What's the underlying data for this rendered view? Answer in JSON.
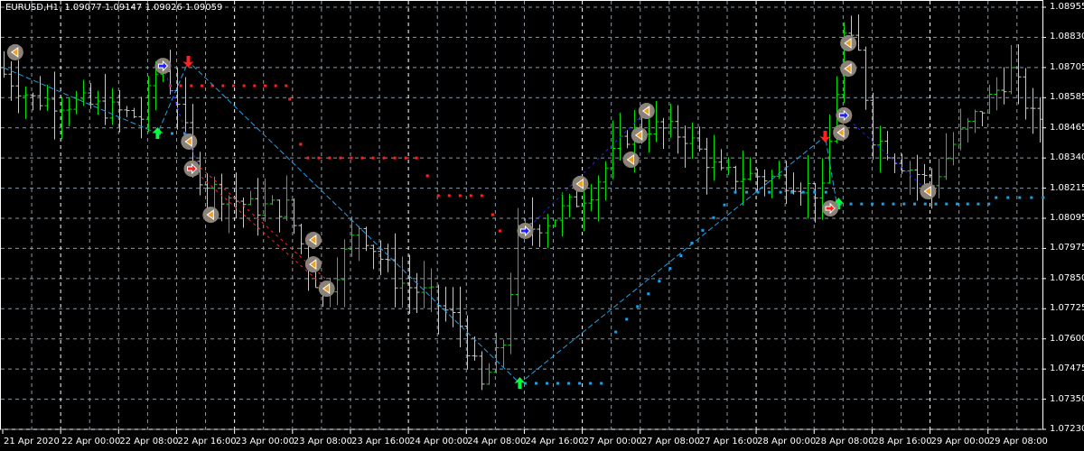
{
  "header": {
    "symbol": "EURUSD,H1",
    "open": "1.09077",
    "high": "1.09147",
    "low": "1.09026",
    "close": "1.09059"
  },
  "colors": {
    "background": "#000000",
    "bull_bar": "#00e000",
    "bear_bar": "#c8c8c8",
    "grid": "#8a9aa8",
    "cyan": "#1ea0e6",
    "red": "#ff2020",
    "blue": "#2020ff",
    "green_arrow": "#00ff40",
    "marker_circle": "#8c8378",
    "marker_triangle": "#f0a020"
  },
  "y_axis": {
    "labels": [
      "1.08955",
      "1.08830",
      "1.08705",
      "1.08585",
      "1.08465",
      "1.08340",
      "1.08215",
      "1.08095",
      "1.07975",
      "1.07850",
      "1.07725",
      "1.07600",
      "1.07475",
      "1.07350",
      "1.07230"
    ],
    "max": 1.08955,
    "min": 1.0723
  },
  "x_axis": {
    "labels": [
      "21 Apr 2020",
      "22 Apr 00:00",
      "22 Apr 08:00",
      "22 Apr 16:00",
      "23 Apr 00:00",
      "23 Apr 08:00",
      "23 Apr 16:00",
      "24 Apr 00:00",
      "24 Apr 08:00",
      "24 Apr 16:00",
      "27 Apr 00:00",
      "27 Apr 08:00",
      "27 Apr 16:00",
      "28 Apr 00:00",
      "28 Apr 08:00",
      "28 Apr 16:00",
      "29 Apr 00:00",
      "29 Apr 08:00"
    ],
    "bars_per_label": 8,
    "day_separator_labels": [
      1,
      4,
      7,
      10,
      13,
      16
    ]
  },
  "chart_data": {
    "type": "ohlc",
    "bar_count": 144,
    "price_path": [
      [
        0,
        1.08708
      ],
      [
        5,
        1.08579
      ],
      [
        12,
        1.08561
      ],
      [
        20,
        1.08505
      ],
      [
        22.5,
        1.08726
      ],
      [
        25,
        1.08579
      ],
      [
        27,
        1.08303
      ],
      [
        30,
        1.0821
      ],
      [
        35,
        1.08137
      ],
      [
        40,
        1.08137
      ],
      [
        45,
        1.07768
      ],
      [
        50,
        1.08063
      ],
      [
        55,
        1.07842
      ],
      [
        60,
        1.07768
      ],
      [
        64,
        1.07657
      ],
      [
        67,
        1.07399
      ],
      [
        70,
        1.07584
      ],
      [
        72,
        1.08026
      ],
      [
        77,
        1.081
      ],
      [
        82,
        1.0821
      ],
      [
        87,
        1.08432
      ],
      [
        90,
        1.08468
      ],
      [
        95,
        1.08432
      ],
      [
        100,
        1.08266
      ],
      [
        105,
        1.08266
      ],
      [
        110,
        1.08247
      ],
      [
        114,
        1.08192
      ],
      [
        115.5,
        1.08505
      ],
      [
        117,
        1.08837
      ],
      [
        119,
        1.08763
      ],
      [
        121,
        1.08432
      ],
      [
        125,
        1.08321
      ],
      [
        129,
        1.08229
      ],
      [
        132,
        1.08395
      ],
      [
        137,
        1.08579
      ],
      [
        140,
        1.0869
      ],
      [
        143,
        1.08505
      ]
    ],
    "markers": [
      [
        1.6,
        1.08771,
        "tri"
      ],
      [
        22,
        1.08715,
        "blue"
      ],
      [
        25.6,
        1.08406,
        "tri"
      ],
      [
        26,
        1.08295,
        "red"
      ],
      [
        28.6,
        1.08107,
        "tri"
      ],
      [
        42.75,
        1.08004,
        "tri"
      ],
      [
        42.75,
        1.07904,
        "tri"
      ],
      [
        44.6,
        1.07805,
        "tri"
      ],
      [
        72,
        1.08041,
        "blue"
      ],
      [
        79.6,
        1.08233,
        "tri"
      ],
      [
        86.6,
        1.08332,
        "tri"
      ],
      [
        87.75,
        1.08432,
        "tri"
      ],
      [
        88.75,
        1.08531,
        "tri"
      ],
      [
        116.6,
        1.08808,
        "tri"
      ],
      [
        116.6,
        1.08704,
        "tri"
      ],
      [
        116,
        1.08513,
        "blue"
      ],
      [
        115.6,
        1.08443,
        "tri"
      ],
      [
        114.1,
        1.08133,
        "red"
      ],
      [
        127.6,
        1.08203,
        "tri"
      ]
    ],
    "arrows_up": [
      [
        21.25,
        1.08439
      ],
      [
        71.25,
        1.07418
      ],
      [
        115.25,
        1.08151
      ]
    ],
    "arrows_down": [
      [
        25.5,
        1.08734
      ],
      [
        113.4,
        1.08428
      ]
    ],
    "zigzag_cyan": [
      [
        0,
        1.08708
      ],
      [
        21.25,
        1.08439
      ],
      [
        25.5,
        1.08734
      ],
      [
        71.25,
        1.07418
      ],
      [
        113.4,
        1.08428
      ],
      [
        115,
        1.08151
      ]
    ],
    "zigzag_blue": [
      [
        [
          22,
          1.08715
        ],
        [
          25.6,
          1.08406
        ],
        [
          27,
          1.08295
        ]
      ],
      [
        [
          72,
          1.08041
        ],
        [
          88.75,
          1.08531
        ]
      ],
      [
        [
          116,
          1.08513
        ],
        [
          127.6,
          1.08203
        ]
      ]
    ],
    "dots_red": [
      [
        [
          23,
          1.08634
        ],
        [
          39,
          1.08634
        ]
      ],
      [
        [
          39.5,
          1.08579
        ],
        [
          39.5,
          1.08579
        ]
      ],
      [
        [
          41,
          1.08395
        ],
        [
          41,
          1.08395
        ]
      ],
      [
        [
          42,
          1.08339
        ],
        [
          57,
          1.08339
        ]
      ],
      [
        [
          58.5,
          1.08266
        ],
        [
          58.5,
          1.08266
        ]
      ],
      [
        [
          60,
          1.08185
        ],
        [
          66,
          1.08185
        ]
      ],
      [
        [
          67.5,
          1.08107
        ],
        [
          67.5,
          1.08107
        ]
      ],
      [
        [
          68.5,
          1.08041
        ],
        [
          68.5,
          1.08041
        ]
      ]
    ],
    "dots_cyan": [
      [
        [
          21.5,
          1.08439
        ],
        [
          25,
          1.08439
        ]
      ],
      [
        [
          72,
          1.07418
        ],
        [
          82.5,
          1.07418
        ]
      ],
      [
        [
          84.5,
          1.07628
        ],
        [
          101,
          1.08199
        ]
      ],
      [
        [
          101,
          1.08199
        ],
        [
          113.5,
          1.08199
        ]
      ],
      [
        [
          115.5,
          1.08151
        ],
        [
          136,
          1.08151
        ]
      ],
      [
        [
          137,
          1.08177
        ],
        [
          143.5,
          1.08177
        ]
      ]
    ]
  }
}
